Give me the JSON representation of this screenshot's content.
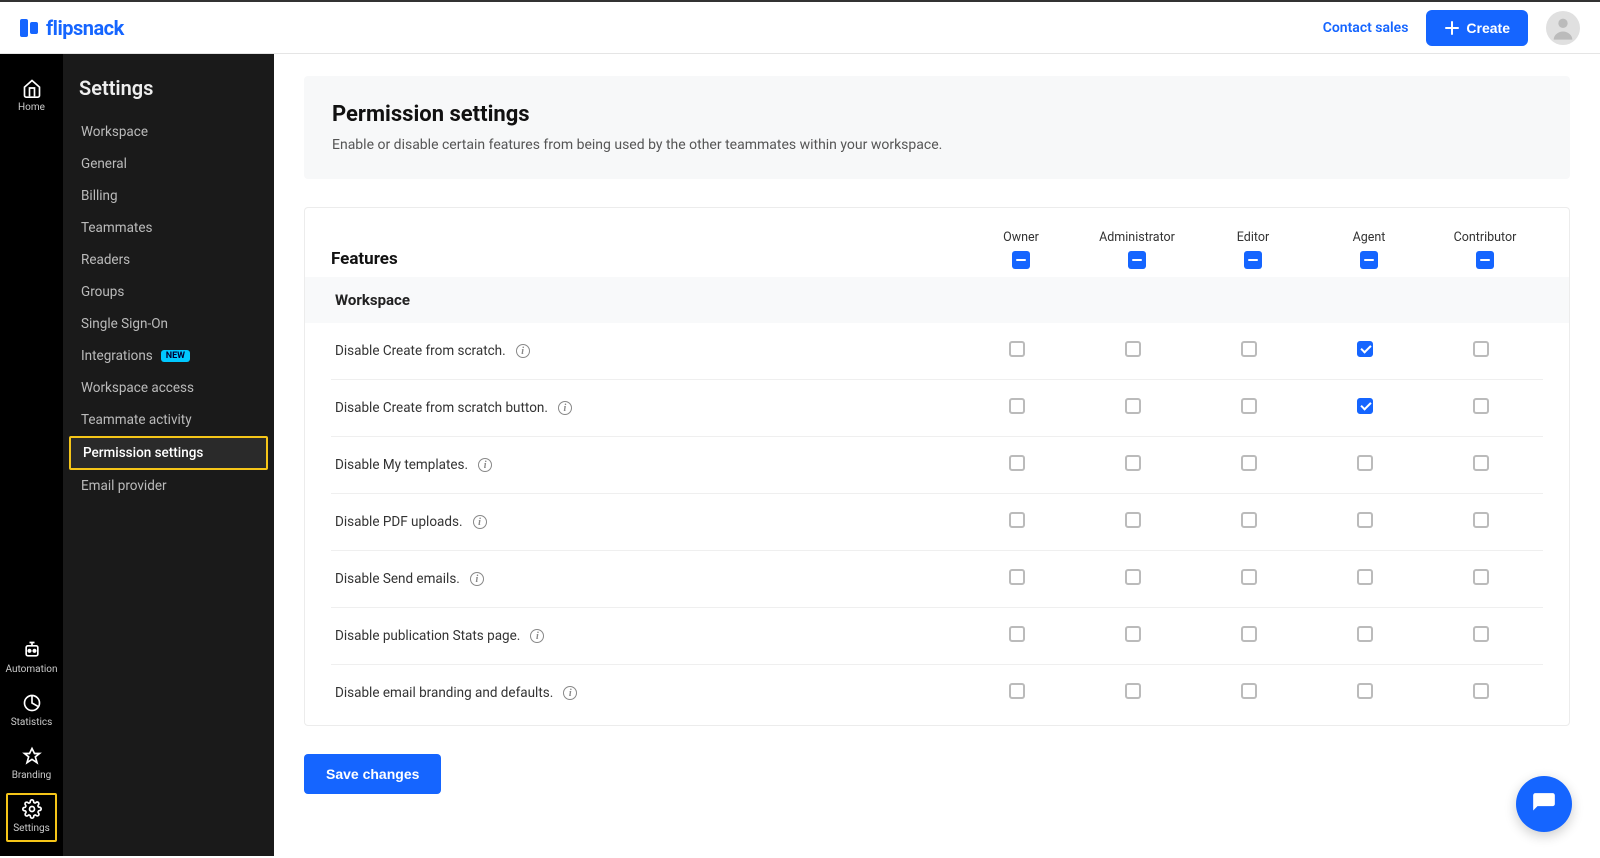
{
  "header": {
    "logo_text": "flipsnack",
    "contact_label": "Contact sales",
    "create_label": "Create"
  },
  "left_rail": {
    "home": "Home",
    "automation": "Automation",
    "statistics": "Statistics",
    "branding": "Branding",
    "settings": "Settings"
  },
  "sidebar": {
    "title": "Settings",
    "items": [
      {
        "label": "Workspace"
      },
      {
        "label": "General"
      },
      {
        "label": "Billing"
      },
      {
        "label": "Teammates"
      },
      {
        "label": "Readers"
      },
      {
        "label": "Groups"
      },
      {
        "label": "Single Sign-On"
      },
      {
        "label": "Integrations",
        "badge": "NEW"
      },
      {
        "label": "Workspace access"
      },
      {
        "label": "Teammate activity"
      },
      {
        "label": "Permission settings",
        "active": true
      },
      {
        "label": "Email provider"
      }
    ]
  },
  "page": {
    "title": "Permission settings",
    "description": "Enable or disable certain features from being used by the other teammates within your workspace."
  },
  "table": {
    "features_heading": "Features",
    "roles": [
      "Owner",
      "Administrator",
      "Editor",
      "Agent",
      "Contributor"
    ],
    "section_title": "Workspace",
    "rows": [
      {
        "label": "Disable Create from scratch.",
        "checks": [
          false,
          false,
          false,
          true,
          false
        ]
      },
      {
        "label": "Disable Create from scratch button.",
        "checks": [
          false,
          false,
          false,
          true,
          false
        ]
      },
      {
        "label": "Disable My templates.",
        "checks": [
          false,
          false,
          false,
          false,
          false
        ]
      },
      {
        "label": "Disable PDF uploads.",
        "checks": [
          false,
          false,
          false,
          false,
          false
        ]
      },
      {
        "label": "Disable Send emails.",
        "checks": [
          false,
          false,
          false,
          false,
          false
        ]
      },
      {
        "label": "Disable publication Stats page.",
        "checks": [
          false,
          false,
          false,
          false,
          false
        ]
      },
      {
        "label": "Disable email branding and defaults.",
        "checks": [
          false,
          false,
          false,
          false,
          false
        ]
      }
    ]
  },
  "actions": {
    "save_label": "Save changes"
  }
}
